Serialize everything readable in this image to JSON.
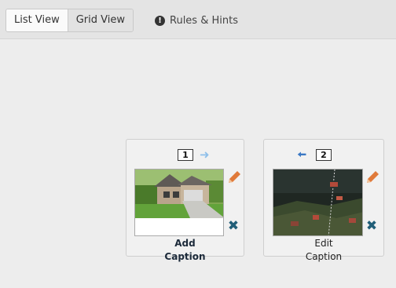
{
  "toolbar": {
    "list_view_label": "List View",
    "grid_view_label": "Grid View",
    "rules_label": "Rules & Hints",
    "rules_icon": "exclamation-circle-icon"
  },
  "cards": [
    {
      "number": "1",
      "arrow": "arrow-right-icon",
      "photo": "house-exterior-photo",
      "caption_line1": "Add",
      "caption_line2": "Caption"
    },
    {
      "number": "2",
      "arrow": "arrow-left-icon",
      "photo": "aerial-map-photo",
      "caption_line1": "Edit",
      "caption_line2": "Caption"
    }
  ],
  "colors": {
    "pencil": "#e07a3a",
    "delete": "#215e78",
    "arrow_active": "#3a78c4",
    "arrow_muted": "#8fc0ea"
  }
}
